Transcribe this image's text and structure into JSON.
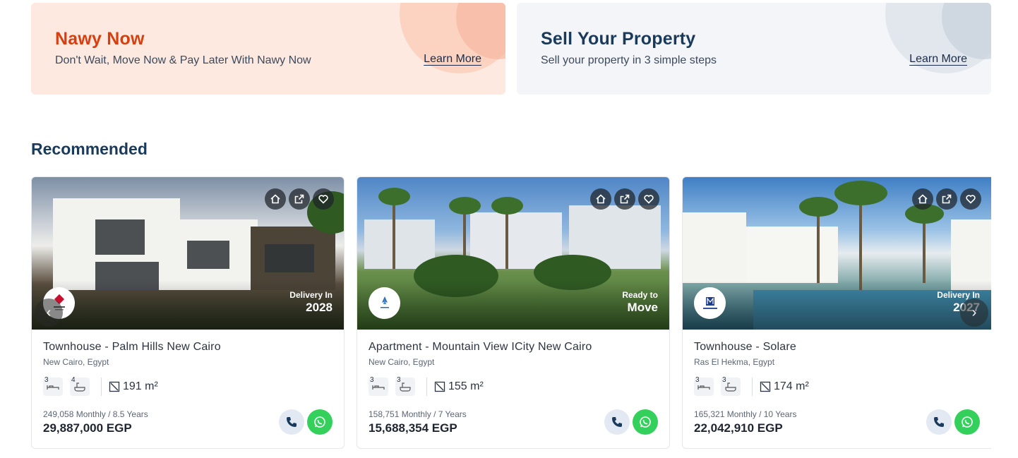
{
  "banners": {
    "now": {
      "title": "Nawy Now",
      "subtitle": "Don't Wait, Move Now & Pay Later With Nawy Now",
      "link": "Learn More"
    },
    "sell": {
      "title": "Sell Your Property",
      "subtitle": "Sell your property in 3 simple steps",
      "link": "Learn More"
    }
  },
  "section_title": "Recommended",
  "cards": [
    {
      "title": "Townhouse - Palm Hills New Cairo",
      "location": "New Cairo, Egypt",
      "bedrooms": "3",
      "bathrooms": "4",
      "area": "191 m²",
      "monthly": "249,058 Monthly / 8.5 Years",
      "price": "29,887,000 EGP",
      "badge_small": "Delivery In",
      "badge_big": "2028",
      "developer_logo": "palm-hills-logo"
    },
    {
      "title": "Apartment - Mountain View ICity New Cairo",
      "location": "New Cairo, Egypt",
      "bedrooms": "3",
      "bathrooms": "3",
      "area": "155 m²",
      "monthly": "158,751 Monthly / 7 Years",
      "price": "15,688,354 EGP",
      "badge_small": "Ready to",
      "badge_big": "Move",
      "developer_logo": "mountain-view-logo"
    },
    {
      "title": "Townhouse - Solare",
      "location": "Ras El Hekma, Egypt",
      "bedrooms": "3",
      "bathrooms": "3",
      "area": "174 m²",
      "monthly": "165,321 Monthly / 10 Years",
      "price": "22,042,910 EGP",
      "badge_small": "Delivery In",
      "badge_big": "2027",
      "developer_logo": "misr-italia-logo"
    }
  ],
  "colors": {
    "accent_orange": "#d6400f",
    "navy": "#1a3a5c",
    "whatsapp": "#33d15c"
  },
  "icons": [
    "home-icon",
    "share-icon",
    "heart-icon",
    "bed-icon",
    "bath-icon",
    "area-icon",
    "phone-icon",
    "whatsapp-icon",
    "chevron-left-icon",
    "chevron-right-icon"
  ]
}
